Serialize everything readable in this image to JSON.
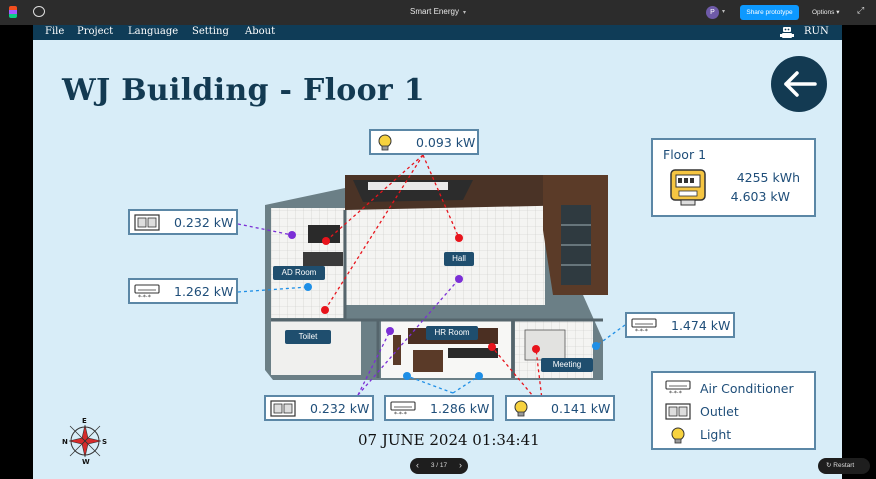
{
  "app": {
    "title": "Smart Energy",
    "avatar_initial": "P",
    "share_label": "Share prototype",
    "options_label": "Options",
    "restart_label": "Restart"
  },
  "menu": {
    "items": [
      {
        "label": "File"
      },
      {
        "label": "Project"
      },
      {
        "label": "Language"
      },
      {
        "label": "Setting"
      },
      {
        "label": "About"
      }
    ],
    "run_label": "RUN"
  },
  "page": {
    "title": "WJ Building - Floor 1",
    "datetime": "07 JUNE 2024 01:34:41",
    "pager": "3 / 17"
  },
  "floor_summary": {
    "title": "Floor 1",
    "energy": "4255 kWh",
    "power": "4.603 kW",
    "icon": "electric-meter-icon"
  },
  "readings": {
    "hall_light": {
      "value": "0.093 kW",
      "icon": "light-bulb-icon"
    },
    "ad_outlet": {
      "value": "0.232 kW",
      "icon": "outlet-icon"
    },
    "ad_ac": {
      "value": "1.262 kW",
      "icon": "air-conditioner-icon"
    },
    "meeting_ac": {
      "value": "1.474 kW",
      "icon": "air-conditioner-icon"
    },
    "hr_outlet": {
      "value": "0.232 kW",
      "icon": "outlet-icon"
    },
    "hr_ac": {
      "value": "1.286 kW",
      "icon": "air-conditioner-icon"
    },
    "hr_light": {
      "value": "0.141 kW",
      "icon": "light-bulb-icon"
    }
  },
  "rooms": {
    "ad_room": "AD Room",
    "hall": "Hall",
    "toilet": "Toilet",
    "hr_room": "HR Room",
    "meeting": "Meeting"
  },
  "legend": {
    "air_conditioner": "Air Conditioner",
    "outlet": "Outlet",
    "light": "Light"
  },
  "compass": {
    "n": "N",
    "e": "E",
    "s": "S",
    "w": "W"
  },
  "colors": {
    "navy": "#133a52",
    "menubar": "#0f3c57",
    "background": "#d8edf8",
    "card_border": "#5b87a6",
    "light_dot": "#e8141c",
    "outlet_dot": "#7b2fd6",
    "ac_dot": "#1f8fe6",
    "share_blue": "#0d99ff"
  }
}
